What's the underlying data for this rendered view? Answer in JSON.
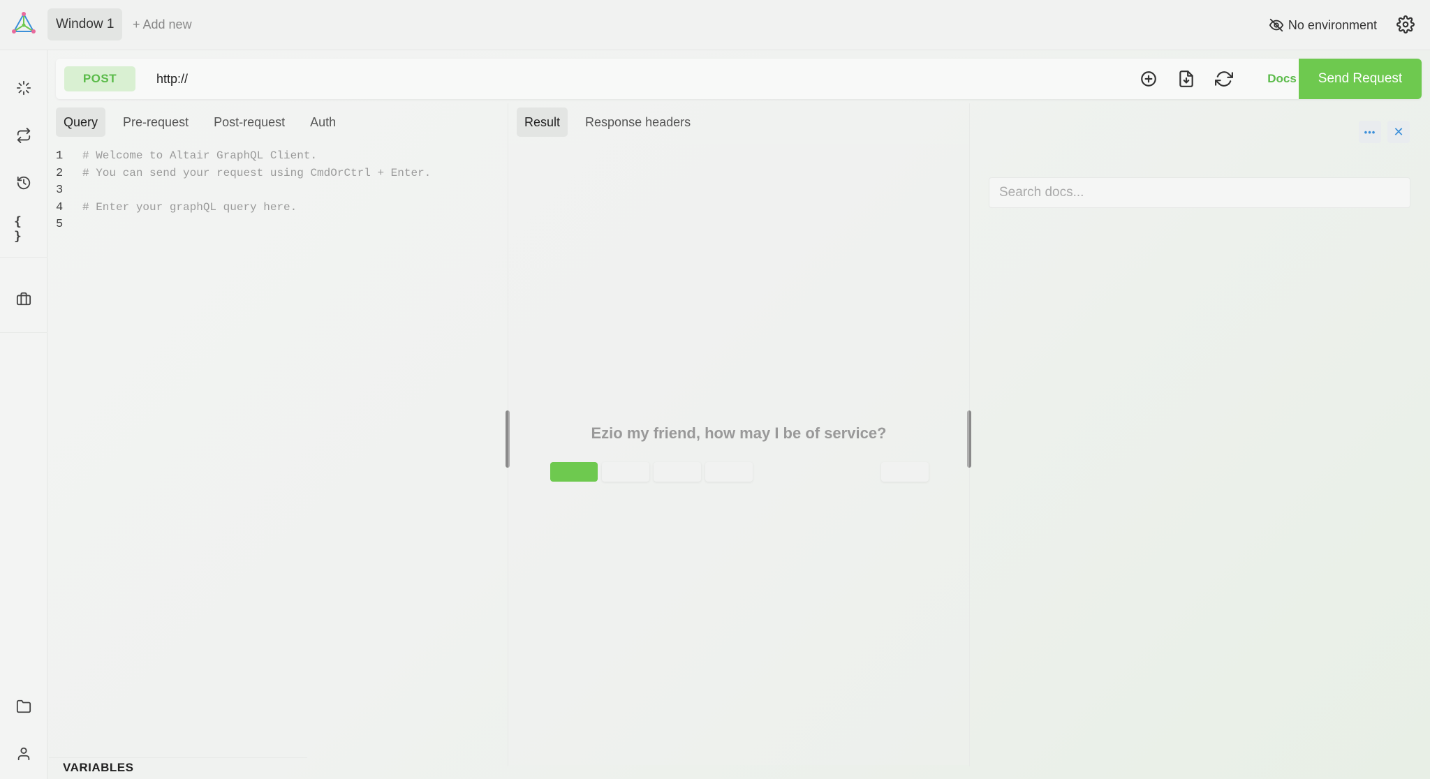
{
  "topbar": {
    "window_tab": "Window 1",
    "add_new": "+ Add new",
    "environment": "No environment"
  },
  "icons": {
    "logo": "altair-logo",
    "environment": "eye-off-icon",
    "settings": "gear-icon",
    "sidebar": [
      "loader-icon",
      "repeat-icon",
      "history-icon",
      "braces-icon",
      "briefcase-icon",
      "folder-icon",
      "user-icon"
    ],
    "url_actions": [
      "plus-circle-icon",
      "file-download-icon",
      "refresh-icon"
    ]
  },
  "sidebar": {
    "braces_glyph": "{ }"
  },
  "request": {
    "method": "POST",
    "url": "http://",
    "docs_label": "Docs",
    "send_label": "Send Request"
  },
  "query_tabs": [
    "Query",
    "Pre-request",
    "Post-request",
    "Auth"
  ],
  "result_tabs": [
    "Result",
    "Response headers"
  ],
  "editor": {
    "lines": [
      {
        "num": "1",
        "text": "# Welcome to Altair GraphQL Client."
      },
      {
        "num": "2",
        "text": "# You can send your request using CmdOrCtrl + Enter."
      },
      {
        "num": "3",
        "text": ""
      },
      {
        "num": "4",
        "text": "# Enter your graphQL query here."
      },
      {
        "num": "5",
        "text": ""
      }
    ]
  },
  "variables_label": "VARIABLES",
  "result": {
    "greeting": "Ezio my friend, how may I be of service?"
  },
  "docs": {
    "more_glyph": "•••",
    "close_glyph": "✕",
    "search_placeholder": "Search docs..."
  },
  "colors": {
    "accent_green": "#6ec94f",
    "method_green": "#5bbb4a",
    "docs_blue": "#3b8fd9"
  }
}
